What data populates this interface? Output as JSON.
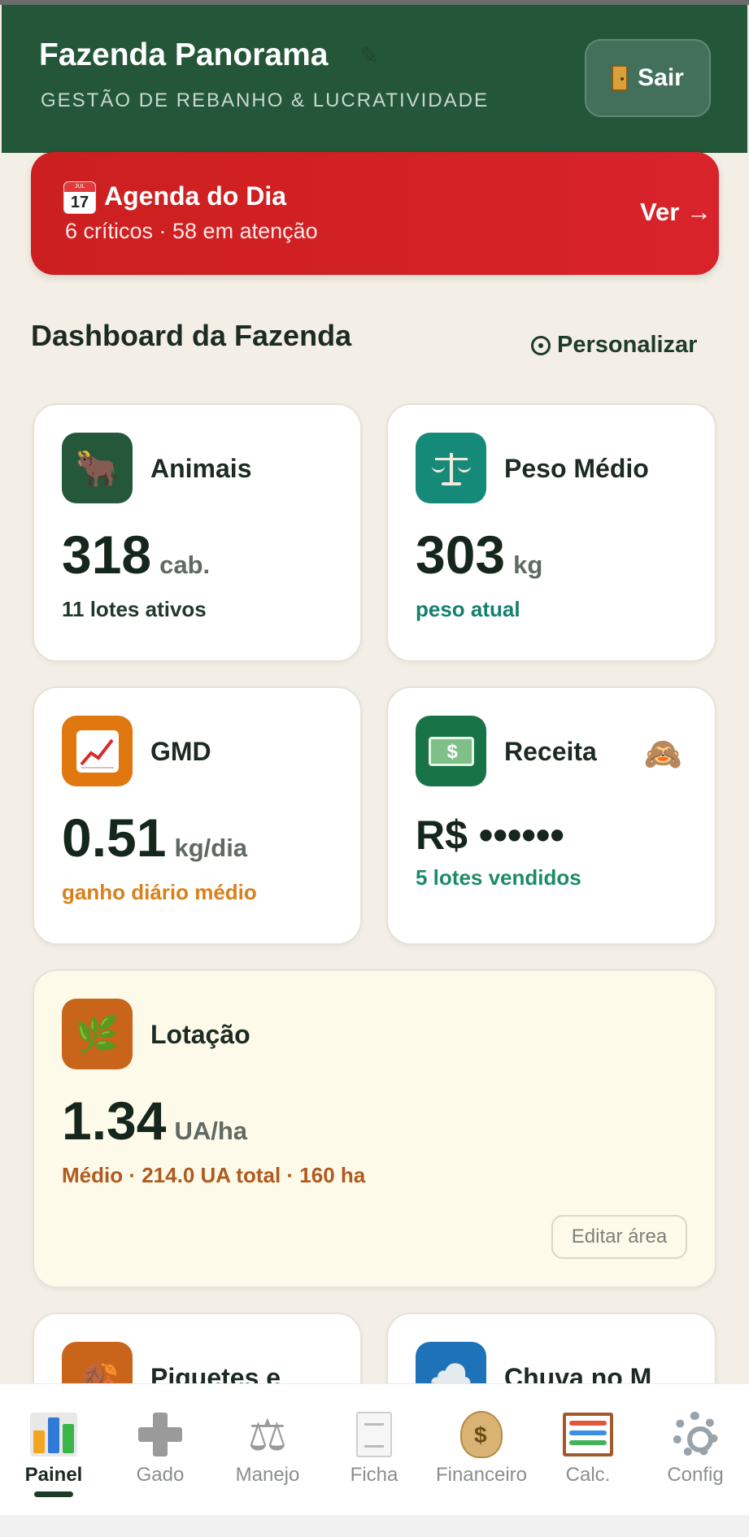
{
  "header": {
    "title": "Fazenda Panorama",
    "subtitle": "GESTÃO DE REBANHO & LUCRATIVIDADE",
    "logout_label": "Sair",
    "colors": {
      "background": "#24563a"
    }
  },
  "agenda": {
    "title": "Agenda do Dia",
    "summary": "6 críticos · 58 em atenção",
    "cta": "Ver →",
    "calendar_month": "JUL",
    "calendar_day": "17",
    "color": "#d8232a"
  },
  "dashboard": {
    "title": "Dashboard da Fazenda",
    "customize_label": "Personalizar"
  },
  "cards": {
    "animals": {
      "label": "Animais",
      "value": "318",
      "unit": "cab.",
      "note": "11 lotes ativos",
      "icon": "cow-icon"
    },
    "weight": {
      "label": "Peso Médio",
      "value": "303",
      "unit": "kg",
      "note": "peso atual",
      "icon": "scale-icon"
    },
    "gmd": {
      "label": "GMD",
      "value": "0.51",
      "unit": "kg/dia",
      "note": "ganho diário médio",
      "icon": "chart-up-icon"
    },
    "revenue": {
      "label": "Receita",
      "value": "R$ ••••••",
      "note": "5 lotes vendidos",
      "icon": "money-icon",
      "hide_icon": "see-no-evil-monkey-icon"
    },
    "stocking": {
      "label": "Lotação",
      "value": "1.34",
      "unit": "UA/ha",
      "note": "Médio · 214.0 UA total · 160 ha",
      "edit_label": "Editar área",
      "icon": "herb-icon"
    },
    "paddocks": {
      "label": "Piquetes e",
      "icon": "leaf-icon"
    },
    "rain": {
      "label": "Chuva no M",
      "icon": "cloud-icon"
    }
  },
  "nav": {
    "items": [
      {
        "label": "Painel",
        "icon": "bar-chart-icon",
        "active": true
      },
      {
        "label": "Gado",
        "icon": "plus-icon"
      },
      {
        "label": "Manejo",
        "icon": "balance-scale-icon"
      },
      {
        "label": "Ficha",
        "icon": "document-icon"
      },
      {
        "label": "Financeiro",
        "icon": "money-bag-icon"
      },
      {
        "label": "Calc.",
        "icon": "abacus-icon"
      },
      {
        "label": "Config",
        "icon": "gear-icon"
      }
    ]
  }
}
